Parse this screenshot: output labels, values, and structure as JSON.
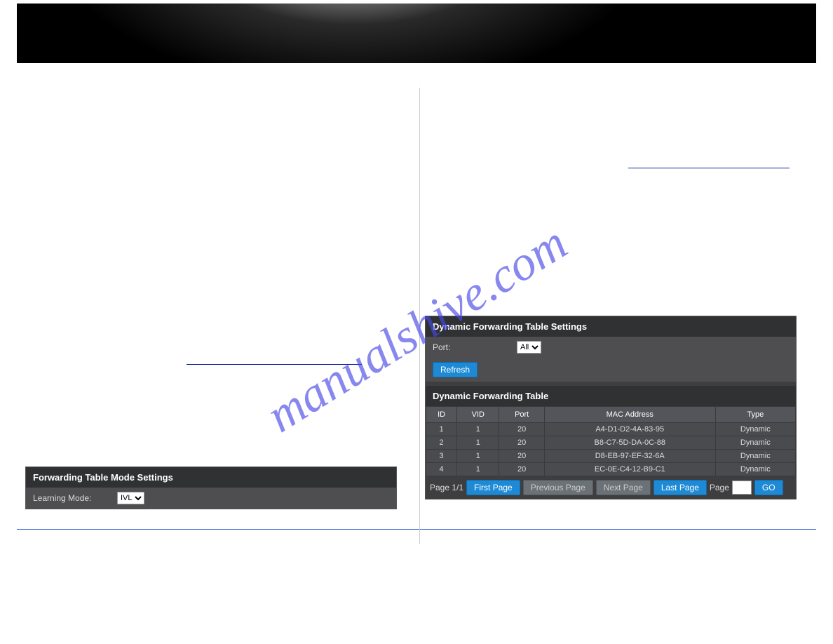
{
  "watermark": "manualshive.com",
  "left": {
    "section_link": "",
    "panel1_title": "Forwarding Table Mode Settings",
    "row1_label": "Learning Mode:",
    "row1_select": "IVL"
  },
  "right": {
    "section_link": "",
    "panel_title": "Dynamic Forwarding Table Settings",
    "port_label": "Port:",
    "port_select": "All",
    "refresh_label": "Refresh",
    "table_title": "Dynamic Forwarding Table",
    "headers": [
      "ID",
      "VID",
      "Port",
      "MAC Address",
      "Type"
    ],
    "rows": [
      {
        "id": "1",
        "vid": "1",
        "port": "20",
        "mac": "A4-D1-D2-4A-83-95",
        "type": "Dynamic"
      },
      {
        "id": "2",
        "vid": "1",
        "port": "20",
        "mac": "B8-C7-5D-DA-0C-88",
        "type": "Dynamic"
      },
      {
        "id": "3",
        "vid": "1",
        "port": "20",
        "mac": "D8-EB-97-EF-32-6A",
        "type": "Dynamic"
      },
      {
        "id": "4",
        "vid": "1",
        "port": "20",
        "mac": "EC-0E-C4-12-B9-C1",
        "type": "Dynamic"
      }
    ],
    "pager": {
      "page_info": "Page 1/1",
      "first": "First Page",
      "prev": "Previous Page",
      "next": "Next Page",
      "last": "Last Page",
      "page_label": "Page",
      "go": "GO"
    }
  }
}
